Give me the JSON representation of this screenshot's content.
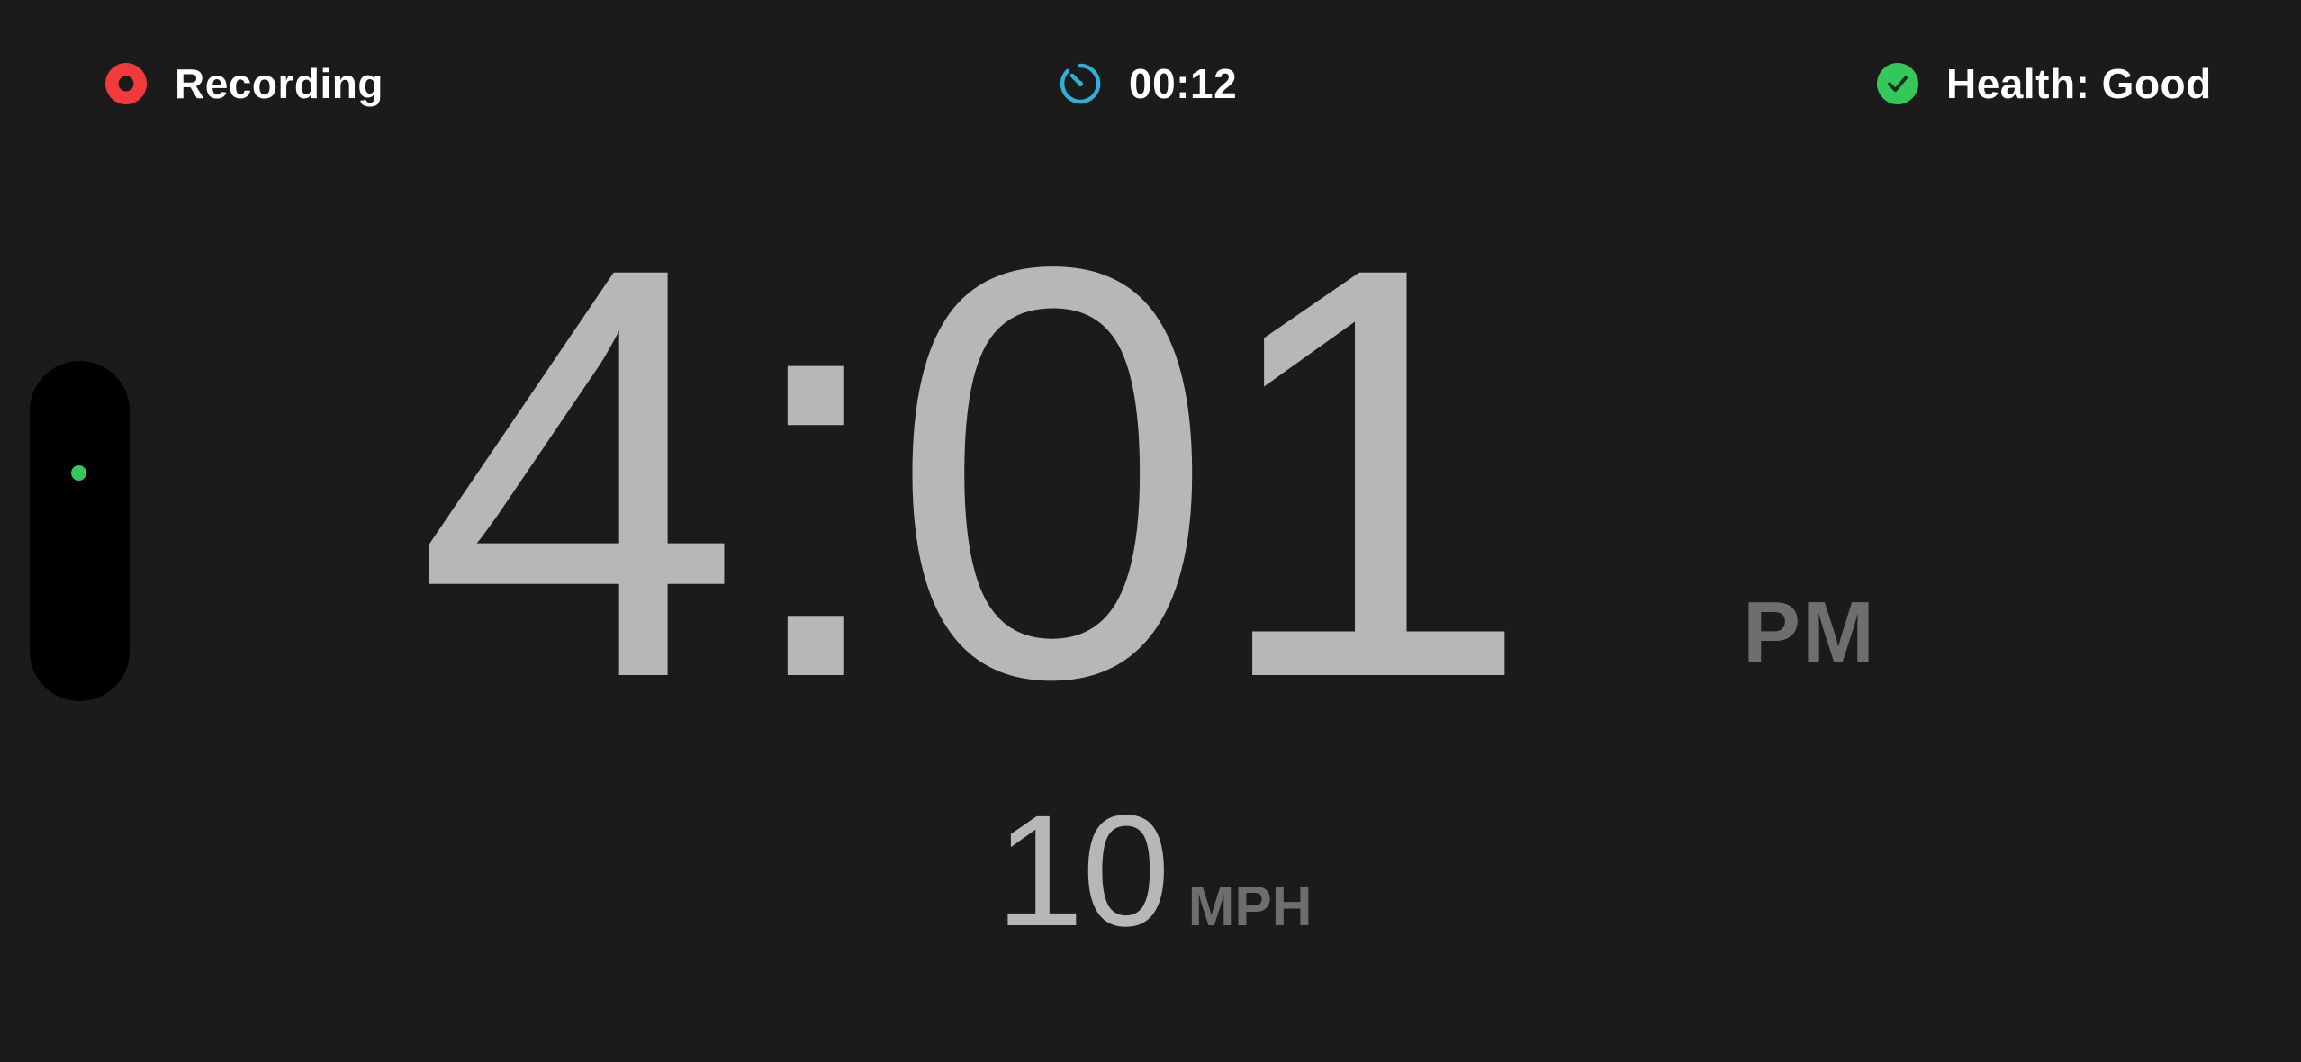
{
  "status_bar": {
    "recording": {
      "label": "Recording",
      "icon": "record-icon",
      "color": "#f2393b"
    },
    "timer": {
      "elapsed": "00:12",
      "icon": "timer-icon",
      "color": "#2fb0d9"
    },
    "health": {
      "label": "Health: Good",
      "icon": "checkmark-circle-icon",
      "color": "#34c759"
    }
  },
  "island": {
    "indicator_color": "#34c759"
  },
  "clock": {
    "time": "4:01",
    "period": "PM",
    "color": "#b7b7b7"
  },
  "speed": {
    "value": "10",
    "unit": "MPH"
  }
}
